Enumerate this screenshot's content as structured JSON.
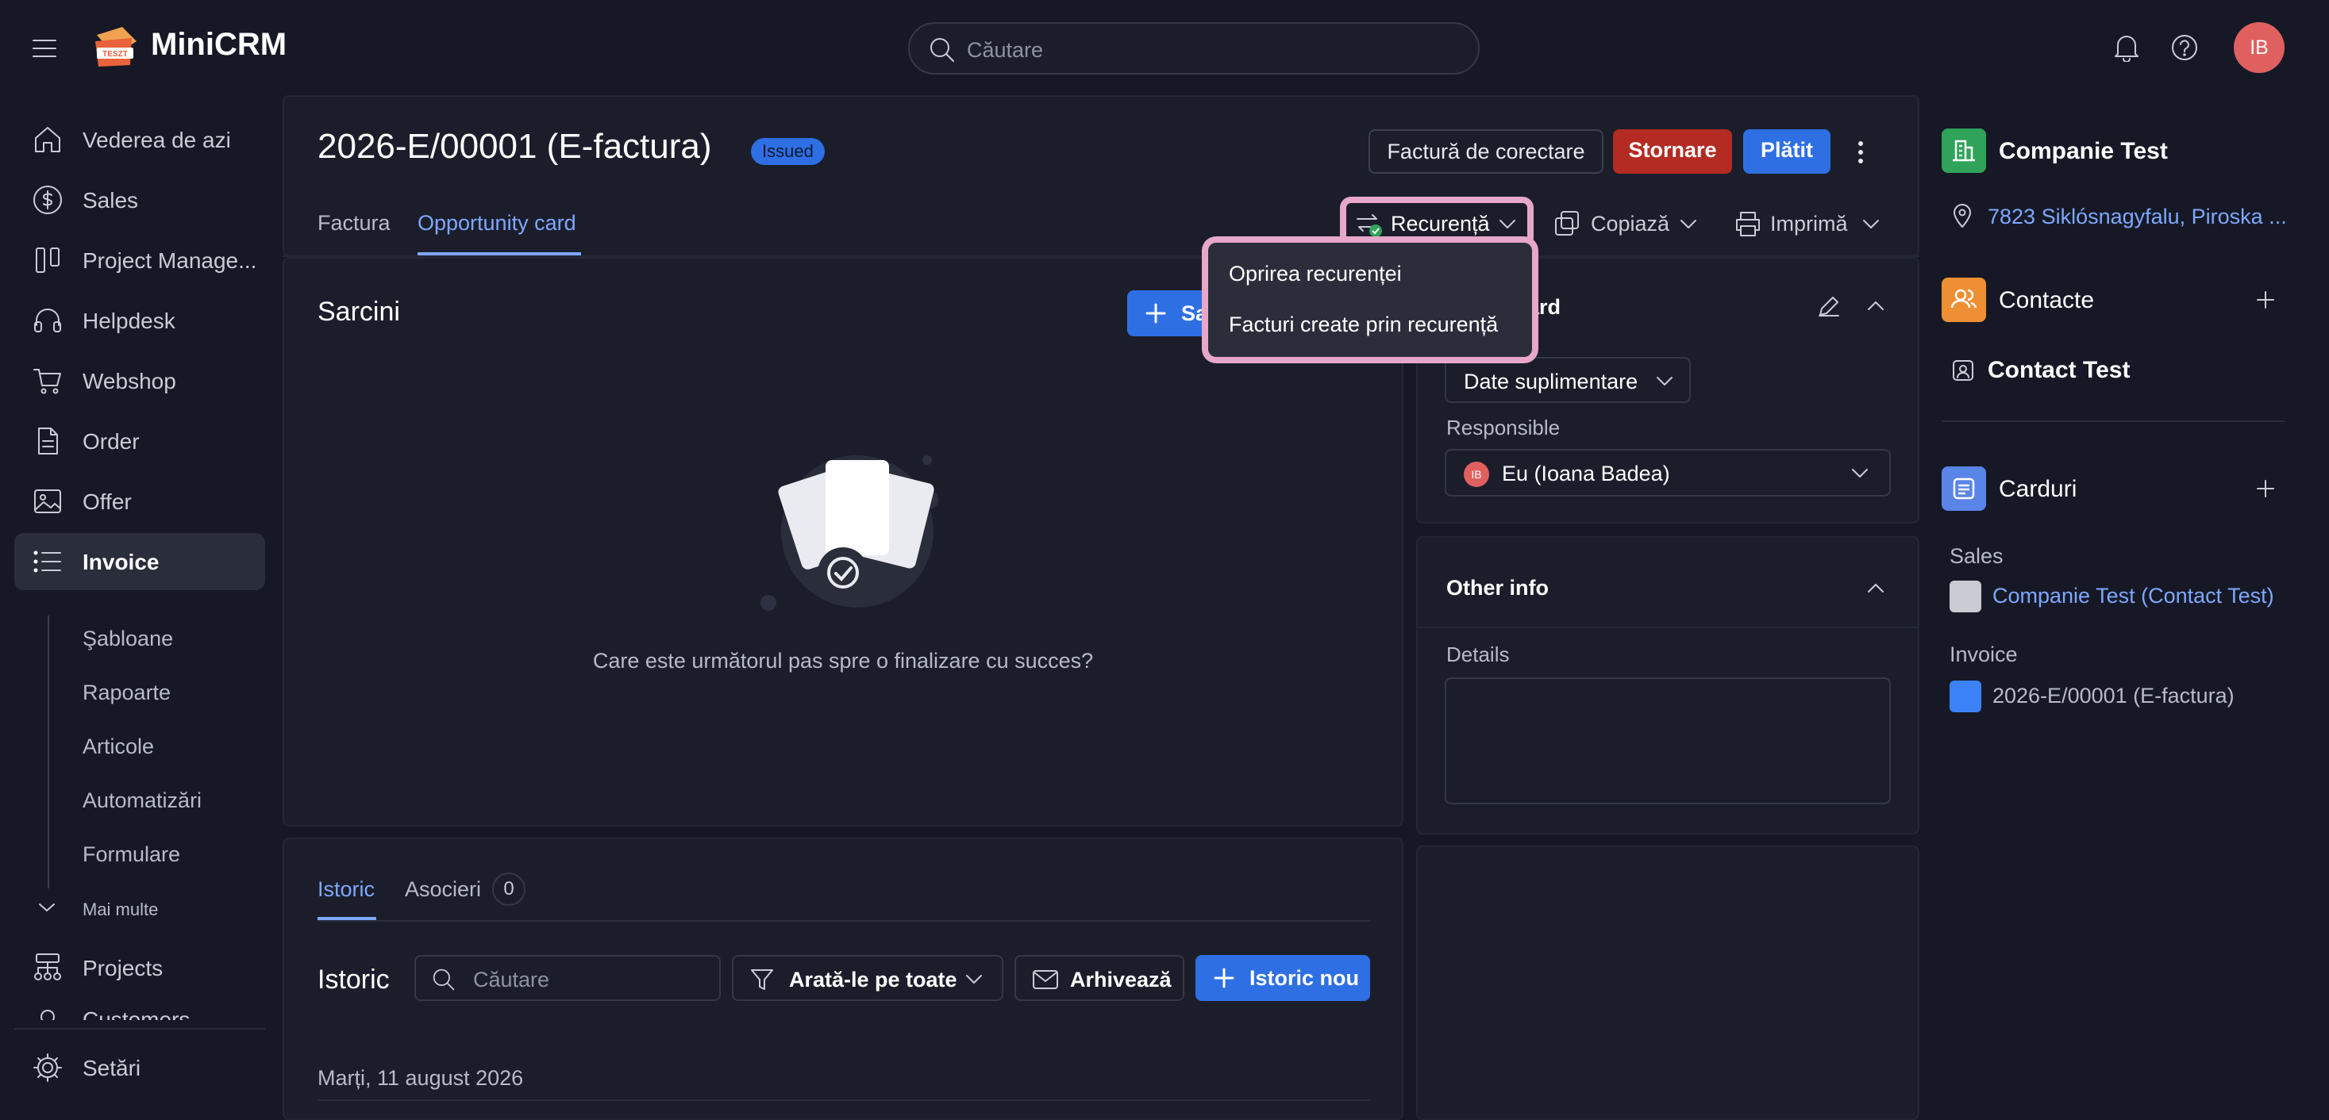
{
  "app": {
    "name": "MiniCRM",
    "logo_badge": "TESZT"
  },
  "search": {
    "placeholder": "Căutare"
  },
  "user": {
    "initials": "IB"
  },
  "sidebar": {
    "items": [
      {
        "label": "Vederea de azi"
      },
      {
        "label": "Sales"
      },
      {
        "label": "Project Manage..."
      },
      {
        "label": "Helpdesk"
      },
      {
        "label": "Webshop"
      },
      {
        "label": "Order"
      },
      {
        "label": "Offer"
      },
      {
        "label": "Invoice"
      }
    ],
    "subitems": [
      "Şabloane",
      "Rapoarte",
      "Articole",
      "Automatizări",
      "Formulare"
    ],
    "more": "Mai multe",
    "projects": "Projects",
    "customers": "Customers",
    "settings": "Setări"
  },
  "header": {
    "title": "2026-E/00001 (E-factura)",
    "status_badge": "Issued",
    "btn_correction": "Factură de corectare",
    "btn_storno": "Stornare",
    "btn_paid": "Plătit",
    "tabs": [
      "Factura",
      "Opportunity card"
    ],
    "recurrence": "Recurență",
    "copy": "Copiază",
    "print": "Imprimă"
  },
  "dropdown": {
    "items": [
      "Oprirea recurenței",
      "Facturi create prin recurență"
    ]
  },
  "tasks": {
    "title": "Sarcini",
    "add_btn": "Sa",
    "empty_text": "Care este următorul pas spre o finalizare cu succes?"
  },
  "opportunity": {
    "title_partial": "ity card",
    "extra_data": "Date suplimentare",
    "responsible_label": "Responsible",
    "responsible_value": "Eu (Ioana Badea)",
    "responsible_initials": "IB"
  },
  "other_info": {
    "title": "Other info",
    "details_label": "Details"
  },
  "history": {
    "tabs": [
      "Istoric",
      "Asocieri"
    ],
    "associations_count": "0",
    "title": "Istoric",
    "search_placeholder": "Căutare",
    "filter": "Arată-le pe toate",
    "archive": "Arhivează",
    "new_btn": "Istoric nou",
    "date": "Marți, 11 august 2026"
  },
  "right": {
    "company": "Companie Test",
    "address": "7823 Siklósnagyfalu, Piroska ...",
    "contacts_title": "Contacte",
    "contact": "Contact Test",
    "cards_title": "Carduri",
    "sales_label": "Sales",
    "sales_card": "Companie Test (Contact Test)",
    "invoice_label": "Invoice",
    "invoice_card": "2026-E/00001 (E-factura)"
  },
  "colors": {
    "accent_blue": "#2f6fe4",
    "link_blue": "#7ea7ff",
    "danger": "#b42b23",
    "highlight": "#e7a7c9"
  }
}
